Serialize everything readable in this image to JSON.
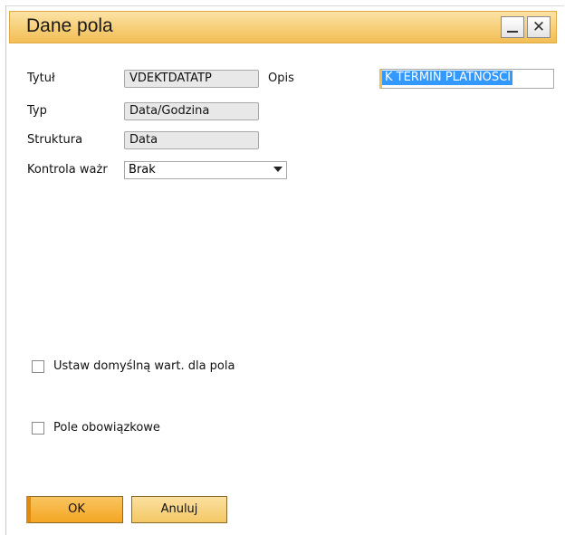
{
  "window": {
    "title": "Dane pola",
    "minimize_glyph": "_",
    "close_glyph": "✕"
  },
  "form": {
    "tytul_label": "Tytuł",
    "tytul_value": "VDEKTDATATP",
    "opis_label": "Opis",
    "opis_value": "K TERMIN PLATNOSCI",
    "typ_label": "Typ",
    "typ_value": "Data/Godzina",
    "struktura_label": "Struktura",
    "struktura_value": "Data",
    "kontrola_label": "Kontrola ważr",
    "kontrola_value": "Brak"
  },
  "options": {
    "default_value_label": "Ustaw domyślną wart. dla pola",
    "mandatory_label": "Pole obowiązkowe"
  },
  "buttons": {
    "ok_label": "OK",
    "cancel_label": "Anuluj"
  },
  "colors": {
    "titlebar": "#f7d07a",
    "ok_button": "#f4a623",
    "selection": "#3399ff"
  }
}
